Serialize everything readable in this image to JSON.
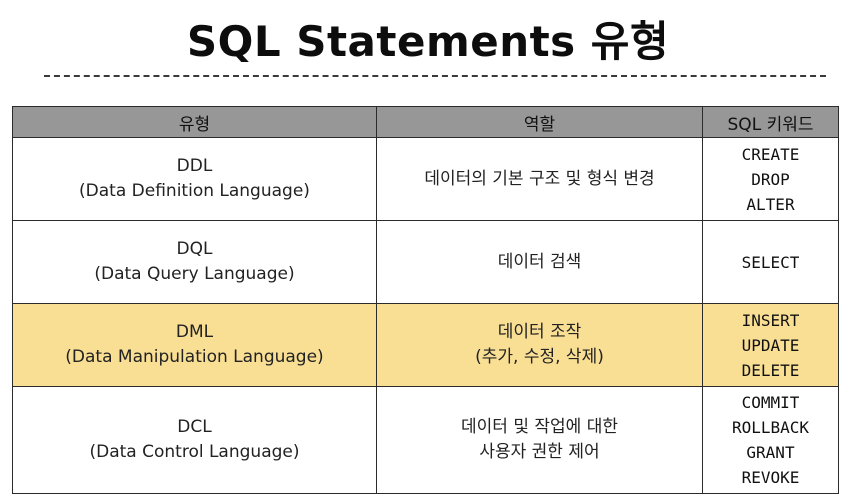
{
  "title": "SQL Statements 유형",
  "colors": {
    "header_bg": "#979797",
    "highlight_bg": "#f9df94",
    "border": "#2b2b2b",
    "divider": "#3a3a3a"
  },
  "table": {
    "headers": [
      "유형",
      "역할",
      "SQL 키워드"
    ],
    "rows": [
      {
        "type_lines": [
          "DDL",
          "(Data Definition Language)"
        ],
        "role_lines": [
          "데이터의 기본 구조 및 형식 변경"
        ],
        "keywords": [
          "CREATE",
          "DROP",
          "ALTER"
        ],
        "highlighted": false
      },
      {
        "type_lines": [
          "DQL",
          "(Data Query Language)"
        ],
        "role_lines": [
          "데이터 검색"
        ],
        "keywords": [
          "SELECT"
        ],
        "highlighted": false
      },
      {
        "type_lines": [
          "DML",
          "(Data Manipulation Language)"
        ],
        "role_lines": [
          "데이터 조작",
          "(추가, 수정, 삭제)"
        ],
        "keywords": [
          "INSERT",
          "UPDATE",
          "DELETE"
        ],
        "highlighted": true
      },
      {
        "type_lines": [
          "DCL",
          "(Data Control Language)"
        ],
        "role_lines": [
          "데이터 및 작업에 대한",
          "사용자 권한 제어"
        ],
        "keywords": [
          "COMMIT",
          "ROLLBACK",
          "GRANT",
          "REVOKE"
        ],
        "highlighted": false
      }
    ]
  }
}
